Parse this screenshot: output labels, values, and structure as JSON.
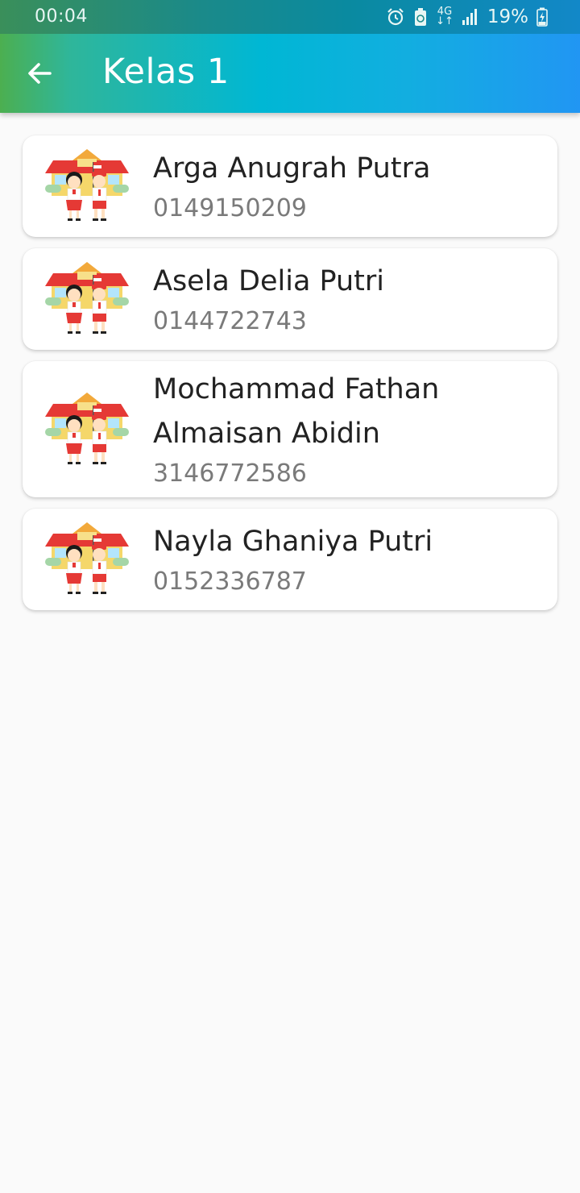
{
  "status_bar": {
    "time": "00:04",
    "network": "4G",
    "battery": "19%"
  },
  "app_bar": {
    "title": "Kelas 1",
    "back_icon": "arrow-left-icon"
  },
  "colors": {
    "gradient_start": "#4caf50",
    "gradient_mid": "#00b7d4",
    "gradient_end": "#2196f3",
    "background": "#fafafa",
    "name_text": "#222222",
    "id_text": "#7a7a7a"
  },
  "students": [
    {
      "name_lines": [
        "Arga Anugrah Putra"
      ],
      "id": "0149150209",
      "avatar_icon": "school-children-icon"
    },
    {
      "name_lines": [
        "Asela Delia Putri"
      ],
      "id": "0144722743",
      "avatar_icon": "school-children-icon"
    },
    {
      "name_lines": [
        "Mochammad Fathan",
        "Almaisan Abidin"
      ],
      "id": "3146772586",
      "avatar_icon": "school-children-icon"
    },
    {
      "name_lines": [
        "Nayla Ghaniya Putri"
      ],
      "id": "0152336787",
      "avatar_icon": "school-children-icon"
    }
  ]
}
